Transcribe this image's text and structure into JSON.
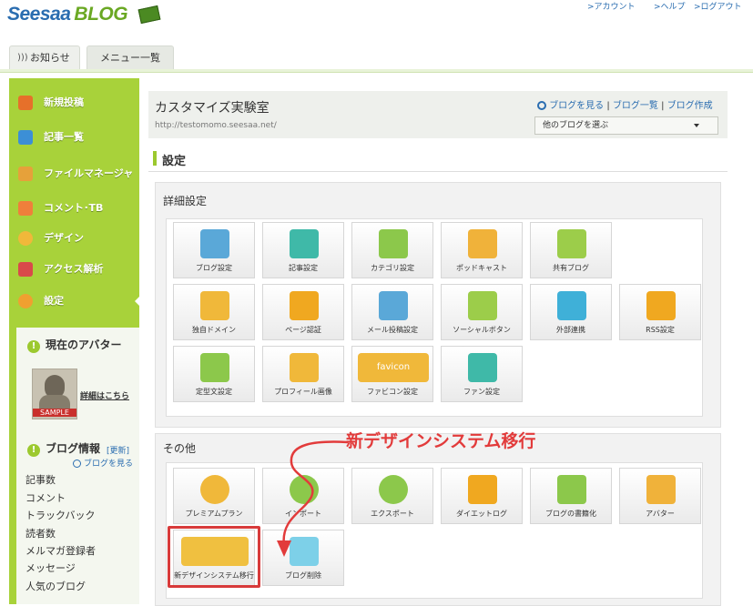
{
  "header": {
    "logo_text": "Seesaa",
    "logo_suffix": "BLOG",
    "links": [
      ">アカウント",
      ">ヘルプ",
      ">ログアウト"
    ]
  },
  "tabs": [
    "お知らせ",
    "メニュー一覧"
  ],
  "sidebar": {
    "items": [
      {
        "label": "新規投稿",
        "icon": "pencil-icon",
        "color": "#e6702a"
      },
      {
        "label": "記事一覧",
        "icon": "document-icon",
        "color": "#3c8fd6"
      },
      {
        "label": "ファイルマネージャ",
        "icon": "file-icon",
        "color": "#e6a13a"
      },
      {
        "label": "コメント･TB",
        "icon": "comment-icon",
        "color": "#ef7f3b"
      },
      {
        "label": "デザイン",
        "icon": "palette-icon",
        "color": "#f0b83a"
      },
      {
        "label": "アクセス解析",
        "icon": "chart-icon",
        "color": "#d94a4a"
      },
      {
        "label": "設定",
        "icon": "gear-icon",
        "color": "#f0a030"
      }
    ],
    "avatar": {
      "title": "現在のアバター",
      "sample_label": "SAMPLE",
      "link": "詳細はこちら"
    },
    "blog_info": {
      "title": "ブログ情報",
      "update": "[更新]",
      "view_link": "ブログを見る",
      "stats": [
        "記事数",
        "コメント",
        "トラックバック",
        "読者数",
        "メルマガ登録者",
        "メッセージ",
        "人気のブログ"
      ]
    }
  },
  "main": {
    "blog_title": "カスタマイズ実験室",
    "blog_url": "http://testomomo.seesaa.net/",
    "view_blog": "ブログを見る",
    "blog_list": "ブログ一覧",
    "blog_create": "ブログ作成",
    "separator": "|",
    "select_placeholder": "他のブログを選ぶ",
    "section_title": "設定",
    "detail_title": "詳細設定",
    "detail_buttons": [
      {
        "label": "ブログ設定",
        "icon": "tools-icon",
        "color": "#5aa8d8"
      },
      {
        "label": "記事設定",
        "icon": "article-icon",
        "color": "#3fb9a8"
      },
      {
        "label": "カテゴリ設定",
        "icon": "folder-icon",
        "color": "#8cc84b"
      },
      {
        "label": "ポッドキャスト",
        "icon": "podcast-icon",
        "color": "#f0b23a"
      },
      {
        "label": "共有ブログ",
        "icon": "notebook-icon",
        "color": "#9ccd4a"
      },
      {
        "label": "独自ドメイン",
        "icon": "www-icon",
        "color": "#f0b83a"
      },
      {
        "label": "ページ認証",
        "icon": "key-icon",
        "color": "#f0a820"
      },
      {
        "label": "メール投稿設定",
        "icon": "mail-tools-icon",
        "color": "#5aa8d8"
      },
      {
        "label": "ソーシャルボタン",
        "icon": "social-icon",
        "color": "#9ccd4a"
      },
      {
        "label": "外部連携",
        "icon": "sync-icon",
        "color": "#3fb0d8"
      },
      {
        "label": "RSS設定",
        "icon": "rss-icon",
        "color": "#f0a820"
      },
      {
        "label": "定型文設定",
        "icon": "template-icon",
        "color": "#8cc84b"
      },
      {
        "label": "プロフィール画像",
        "icon": "profile-icon",
        "color": "#f0b83a"
      },
      {
        "label": "ファビコン設定",
        "icon": "favicon-icon",
        "color": "#f0b83a"
      },
      {
        "label": "ファン設定",
        "icon": "fans-icon",
        "color": "#3fb9a8"
      }
    ],
    "favicon_text": "favicon",
    "other_title": "その他",
    "other_buttons": [
      {
        "label": "プレミアムプラン",
        "icon": "premium-icon",
        "color": "#f0b83a"
      },
      {
        "label": "インポート",
        "icon": "import-icon",
        "color": "#8cc84b"
      },
      {
        "label": "エクスポート",
        "icon": "export-icon",
        "color": "#8cc84b"
      },
      {
        "label": "ダイエットログ",
        "icon": "diet-icon",
        "color": "#f0a820"
      },
      {
        "label": "ブログの書籍化",
        "icon": "book-icon",
        "color": "#8cc84b"
      },
      {
        "label": "アバター",
        "icon": "building-icon",
        "color": "#f0b23a"
      },
      {
        "label": "新デザインシステム移行",
        "icon": "migrate-icon",
        "color": "#f0c040"
      },
      {
        "label": "ブログ削除",
        "icon": "trash-icon",
        "color": "#7dd0e8"
      }
    ],
    "annotation": "新デザインシステム移行"
  }
}
